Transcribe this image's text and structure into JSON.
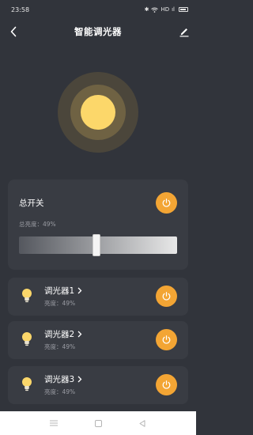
{
  "status_bar": {
    "time": "23:58",
    "bluetooth": "✱",
    "wifi": "wifi-icon",
    "network": "HD",
    "signal": "ıl",
    "battery": "battery-icon"
  },
  "nav": {
    "back_icon": "back-chevron-icon",
    "title": "智能调光器",
    "edit_icon": "edit-pencil-icon"
  },
  "bulb_visual": {
    "core_color": "#fcd76a",
    "mid_color": "#6f6243",
    "outer_color": "#4b463b"
  },
  "master": {
    "label": "总开关",
    "brightness_text": "总亮度：49%",
    "brightness_value": 49,
    "power_color": "#f3a534"
  },
  "dimmers": [
    {
      "name": "调光器1",
      "brightness_text": "亮度：49%",
      "brightness_value": 49,
      "icon": "bulb-icon"
    },
    {
      "name": "调光器2",
      "brightness_text": "亮度：49%",
      "brightness_value": 49,
      "icon": "bulb-icon"
    },
    {
      "name": "调光器3",
      "brightness_text": "亮度：49%",
      "brightness_value": 49,
      "icon": "bulb-icon"
    }
  ],
  "bottom_nav": {
    "menu_icon": "menu-icon",
    "home_icon": "home-square-icon",
    "back_icon": "back-triangle-icon"
  },
  "colors": {
    "background": "#31343b",
    "card": "#393c43",
    "accent": "#f3a534",
    "secondary_text": "#9a9ca3"
  }
}
